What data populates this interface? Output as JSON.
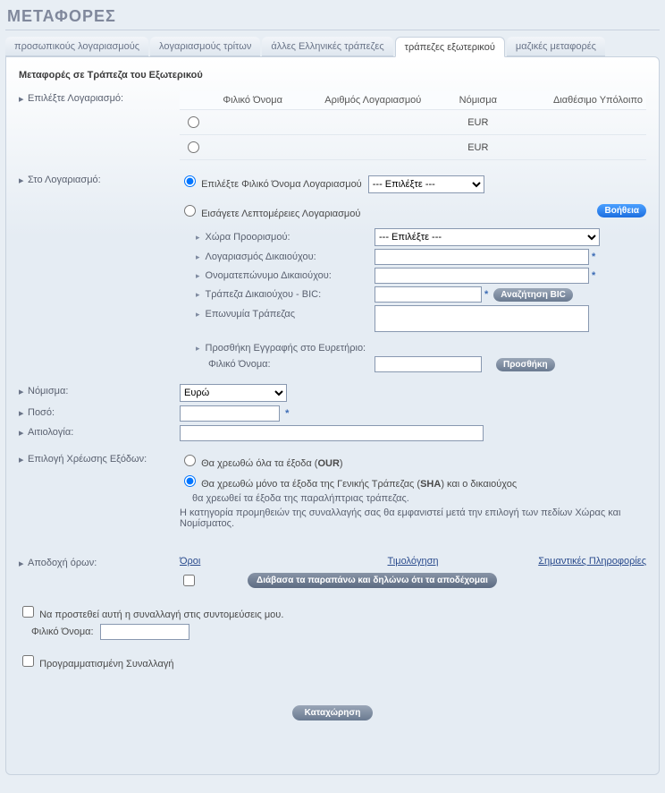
{
  "page": {
    "title": "ΜΕΤΑΦΟΡΕΣ",
    "panel_title": "Μεταφορές σε Τράπεζα του Εξωτερικού"
  },
  "tabs": {
    "items": [
      {
        "label": "προσωπικούς λογαριασμούς"
      },
      {
        "label": "λογαριασμούς τρίτων"
      },
      {
        "label": "άλλες Ελληνικές τράπεζες"
      },
      {
        "label": "τράπεζες εξωτερικού"
      },
      {
        "label": "μαζικές μεταφορές"
      }
    ],
    "active_index": 3
  },
  "labels": {
    "select_account": "Επιλέξτε Λογαριασμό:",
    "to_account": "Στο Λογαριασμό:",
    "currency": "Νόμισμα:",
    "amount": "Ποσό:",
    "reason": "Αιτιολογία:",
    "charges": "Επιλογή Χρέωσης Εξόδων:",
    "accept_terms": "Αποδοχή όρων:"
  },
  "account_table": {
    "headers": {
      "friendly": "Φιλικό Όνομα",
      "number": "Αριθμός Λογαριασμού",
      "currency": "Νόμισμα",
      "balance": "Διαθέσιμο Υπόλοιπο"
    },
    "rows": [
      {
        "friendly": "",
        "number": "",
        "currency": "EUR",
        "balance": ""
      },
      {
        "friendly": "",
        "number": "",
        "currency": "EUR",
        "balance": ""
      }
    ]
  },
  "to_account": {
    "select_friendly_label": "Επιλέξτε Φιλικό Όνομα Λογαριασμού",
    "select_friendly_option": "--- Επιλέξτε ---",
    "enter_details_label": "Εισάγετε Λεπτομέρειες Λογαριασμού",
    "help_button": "Βοήθεια",
    "destination_country": "Χώρα Προορισμού:",
    "destination_country_option": "--- Επιλέξτε ---",
    "beneficiary_account": "Λογαριασμός Δικαιούχου:",
    "beneficiary_name": "Ονοματεπώνυμο Δικαιούχου:",
    "beneficiary_bank_bic": "Τράπεζα Δικαιούχου - BIC:",
    "search_bic": "Αναζήτηση BIC",
    "bank_name": "Επωνυμία Τράπεζας",
    "add_to_index": "Προσθήκη Εγγραφής στο Ευρετήριο:",
    "friendly_name": "Φιλικό Όνομα:",
    "add_button": "Προσθήκη"
  },
  "currency_options": {
    "selected": "Ευρώ"
  },
  "charges": {
    "our_label_pre": "Θα χρεωθώ όλα τα έξοδα (",
    "our_label_bold": "OUR",
    "our_label_post": ")",
    "sha_line1_pre": "Θα χρεωθώ μόνο τα έξοδα της Γενικής Τράπεζας (",
    "sha_line1_bold": "SHA",
    "sha_line1_post": ") και ο δικαιούχος",
    "sha_line2": "θα χρεωθεί τα έξοδα της παραλήπτριας τράπεζας.",
    "note": "Η κατηγορία προμηθειών της συναλλαγής σας θα εμφανιστεί μετά την επιλογή των πεδίων Χώρας και Νομίσματος."
  },
  "terms": {
    "terms_link": "Όροι",
    "pricing_link": "Τιμολόγηση",
    "important_link": "Σημαντικές Πληροφορίες",
    "accept_label": "Διάβασα τα παραπάνω και δηλώνω ότι τα αποδέχομαι"
  },
  "shortcut": {
    "add_label": "Να προστεθεί αυτή η συναλλαγή στις συντομεύσεις μου.",
    "friendly_label": "Φιλικό Όνομα:"
  },
  "scheduled": {
    "label": "Προγραμματισμένη Συναλλαγή"
  },
  "submit": {
    "label": "Καταχώρηση"
  }
}
